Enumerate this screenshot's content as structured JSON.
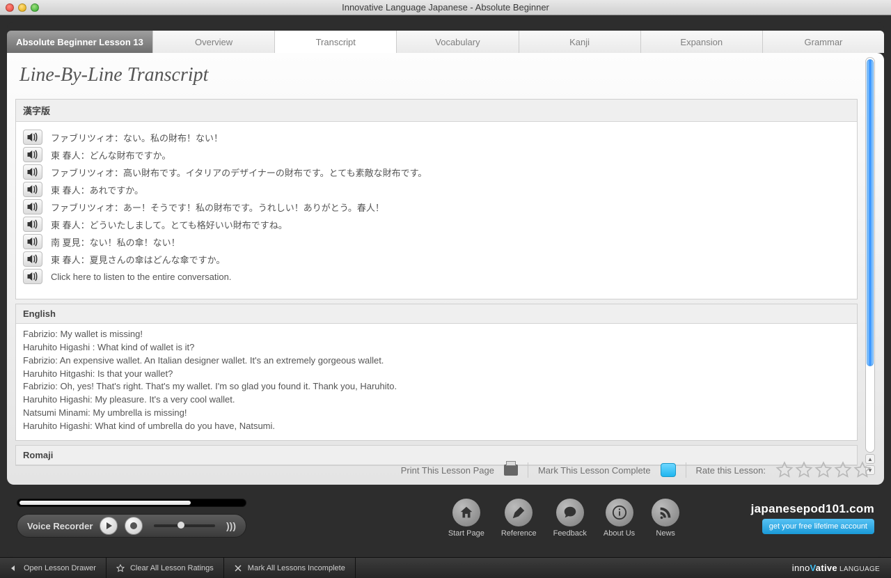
{
  "window": {
    "title": "Innovative Language Japanese - Absolute Beginner"
  },
  "tabs": {
    "lesson": "Absolute Beginner Lesson 13",
    "items": [
      "Overview",
      "Transcript",
      "Vocabulary",
      "Kanji",
      "Expansion",
      "Grammar"
    ],
    "active_index": 1
  },
  "page": {
    "title": "Line-By-Line Transcript"
  },
  "sections": {
    "kanji": {
      "header": "漢字版",
      "lines": [
        "ファブリツィオ：ない。私の財布！ない！",
        "東 春人：どんな財布ですか。",
        "ファブリツィオ：高い財布です。イタリアのデザイナーの財布です。とても素敵な財布です。",
        "東 春人：あれですか。",
        "ファブリツィオ：あー！そうです！私の財布です。うれしい！ありがとう。春人！",
        "東 春人：どういたしまして。とても格好いい財布ですね。",
        "南 夏見：ない！私の傘！ない！",
        "東 春人：夏見さんの傘はどんな傘ですか。",
        "Click here to listen to the entire conversation."
      ]
    },
    "english": {
      "header": "English",
      "lines": [
        "Fabrizio: My wallet is missing!",
        "Haruhito Higashi : What kind of wallet is it?",
        "Fabrizio: An expensive wallet. An Italian designer wallet. It's an extremely gorgeous wallet.",
        "Haruhito Hitgashi: Is that your wallet?",
        "Fabrizio: Oh, yes! That's right. That's my wallet. I'm so glad you found it. Thank you, Haruhito.",
        "Haruhito Higashi: My pleasure. It's a very cool wallet.",
        "Natsumi Minami: My umbrella is missing!",
        "Haruhito Higashi: What kind of umbrella do you have, Natsumi."
      ]
    },
    "romaji": {
      "header": "Romaji"
    }
  },
  "actions": {
    "print": "Print This Lesson Page",
    "mark_complete": "Mark This Lesson Complete",
    "rate": "Rate this Lesson:"
  },
  "recorder": {
    "label": "Voice Recorder"
  },
  "nav": [
    {
      "label": "Start Page",
      "icon": "home"
    },
    {
      "label": "Reference",
      "icon": "pen"
    },
    {
      "label": "Feedback",
      "icon": "bubble"
    },
    {
      "label": "About Us",
      "icon": "info"
    },
    {
      "label": "News",
      "icon": "rss"
    }
  ],
  "brand": {
    "site": "japanesepod101.com",
    "cta": "get your free lifetime account"
  },
  "bottom": {
    "open_drawer": "Open Lesson Drawer",
    "clear_ratings": "Clear All Lesson Ratings",
    "mark_incomplete": "Mark All Lessons Incomplete",
    "logo_a": "inno",
    "logo_v": "V",
    "logo_b": "ative",
    "logo_c": " LANGUAGE"
  }
}
